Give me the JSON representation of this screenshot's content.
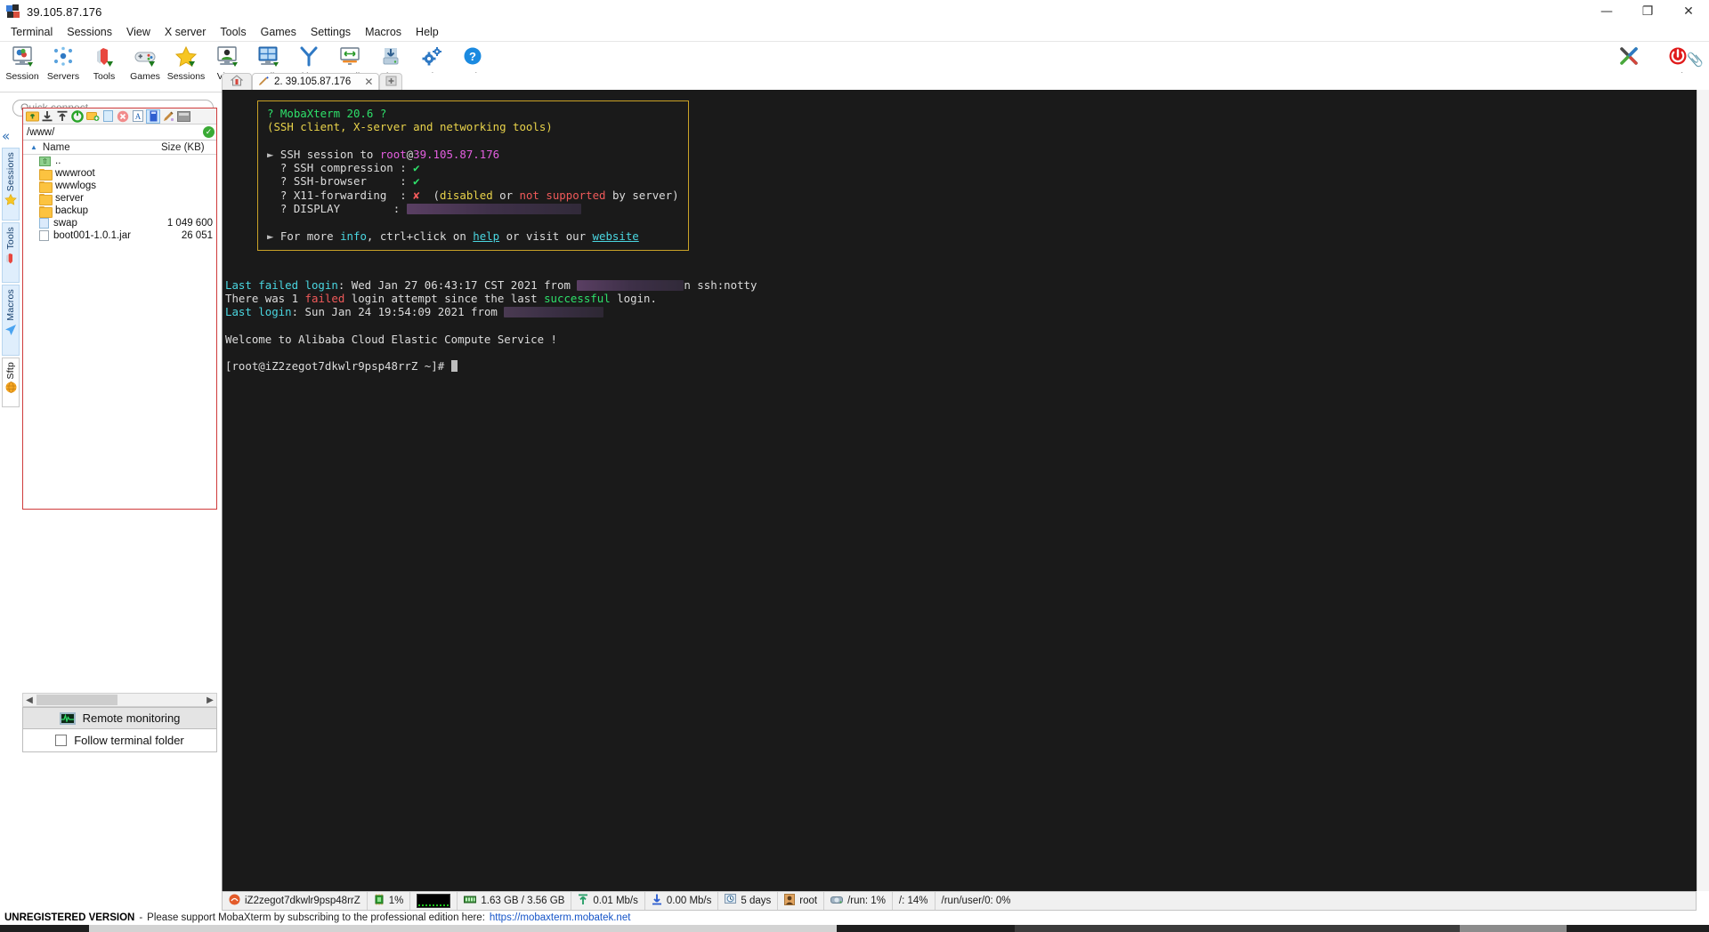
{
  "window": {
    "title": "39.105.87.176",
    "icon": "mobaxterm-logo-icon",
    "minimize": "—",
    "maximize": "❐",
    "close": "✕"
  },
  "menubar": {
    "items": [
      "Terminal",
      "Sessions",
      "View",
      "X server",
      "Tools",
      "Games",
      "Settings",
      "Macros",
      "Help"
    ]
  },
  "ribbon": {
    "items": [
      {
        "label": "Session",
        "icon": "session-icon"
      },
      {
        "label": "Servers",
        "icon": "servers-icon"
      },
      {
        "label": "Tools",
        "icon": "tools-icon"
      },
      {
        "label": "Games",
        "icon": "games-icon"
      },
      {
        "label": "Sessions",
        "icon": "sessions-star-icon"
      },
      {
        "label": "View",
        "icon": "view-icon"
      },
      {
        "label": "Split",
        "icon": "split-icon"
      },
      {
        "label": "MultiExec",
        "icon": "multiexec-icon"
      },
      {
        "label": "Tunneling",
        "icon": "tunneling-icon"
      },
      {
        "label": "Packages",
        "icon": "packages-icon"
      },
      {
        "label": "Settings",
        "icon": "settings-gear-icon"
      },
      {
        "label": "Help",
        "icon": "help-question-icon"
      }
    ],
    "right": [
      {
        "label": "X server",
        "icon": "x-server-icon"
      },
      {
        "label": "Exit",
        "icon": "exit-power-icon"
      }
    ]
  },
  "quick_connect": {
    "placeholder": "Quick connect..."
  },
  "side_tabs": [
    {
      "label": "Sessions",
      "icon": "star-icon",
      "active": false
    },
    {
      "label": "Tools",
      "icon": "tools-icon",
      "active": false
    },
    {
      "label": "Macros",
      "icon": "macros-icon",
      "active": false
    },
    {
      "label": "Sftp",
      "icon": "globe-icon",
      "active": true
    }
  ],
  "file_browser": {
    "toolbar_icons": [
      "go-up-icon",
      "download-icon",
      "upload-icon",
      "refresh-icon",
      "new-folder-icon",
      "new-file-icon",
      "delete-icon",
      "text-edit-icon",
      "bookmark-icon",
      "permissions-icon",
      "terminal-icon"
    ],
    "path": "/www/",
    "path_status_icon": "check-circle-icon",
    "columns": {
      "name": "Name",
      "size": "Size (KB)"
    },
    "rows": [
      {
        "name": "..",
        "size": "",
        "type": "parent"
      },
      {
        "name": "wwwroot",
        "size": "",
        "type": "folder"
      },
      {
        "name": "wwwlogs",
        "size": "",
        "type": "folder"
      },
      {
        "name": "server",
        "size": "",
        "type": "folder"
      },
      {
        "name": "backup",
        "size": "",
        "type": "folder"
      },
      {
        "name": "swap",
        "size": "1 049 600",
        "type": "file-blue"
      },
      {
        "name": "boot001-1.0.1.jar",
        "size": "26 051",
        "type": "file"
      }
    ],
    "remote_monitoring": "Remote monitoring",
    "follow_terminal_folder": "Follow terminal folder",
    "follow_checked": false
  },
  "tabs": {
    "home_icon": "home-icon",
    "items": [
      {
        "label": "2. 39.105.87.176",
        "icon": "ssh-icon",
        "active": true,
        "close": "✕"
      }
    ],
    "new_tab": "+"
  },
  "terminal": {
    "banner": {
      "title": "? MobaXterm 20.6 ?",
      "subtitle": "(SSH client, X-server and networking tools)",
      "session_prefix": "SSH session to ",
      "session_user": "root",
      "session_at": "@",
      "session_host": "39.105.87.176",
      "rows": [
        {
          "label": "? SSH compression",
          "value": "✔",
          "value_class": "ok"
        },
        {
          "label": "? SSH-browser",
          "value": "✔",
          "value_class": "ok"
        },
        {
          "label": "? X11-forwarding",
          "value": "✘",
          "value_class": "bad",
          "note_open": " (",
          "note_yellow": "disabled",
          "note_mid": " or ",
          "note_red": "not supported",
          "note_close": " by server)"
        },
        {
          "label": "? DISPLAY",
          "value": "",
          "value_class": "redacted"
        }
      ],
      "footer_prefix": "For more ",
      "footer_info": "info",
      "footer_mid": ", ctrl+click on ",
      "footer_help": "help",
      "footer_or": " or visit our ",
      "footer_website": "website"
    },
    "lines": {
      "last_failed_label": "Last failed login",
      "last_failed_rest": ": Wed Jan 27 06:43:17 CST 2021 from ",
      "last_failed_tail": "n ssh:notty",
      "attempt_pre": "There was 1 ",
      "attempt_failed": "failed",
      "attempt_mid": " login attempt since the last ",
      "attempt_success": "successful",
      "attempt_end": " login.",
      "last_login_label": "Last login",
      "last_login_rest": ": Sun Jan 24 19:54:09 2021 from ",
      "welcome": "Welcome to Alibaba Cloud Elastic Compute Service !",
      "prompt": "[root@iZ2zegot7dkwlr9psp48rrZ ~]#"
    }
  },
  "statusbar": {
    "items": [
      {
        "icon": "host-icon",
        "text": "iZ2zegot7dkwlr9psp48rrZ"
      },
      {
        "icon": "cpu-icon",
        "text": "1%"
      },
      {
        "icon": "graph-icon",
        "text": ""
      },
      {
        "icon": "memory-icon",
        "text": "1.63 GB / 3.56 GB"
      },
      {
        "icon": "upload-icon",
        "text": "0.01 Mb/s"
      },
      {
        "icon": "download-icon",
        "text": "0.00 Mb/s"
      },
      {
        "icon": "uptime-icon",
        "text": "5 days"
      },
      {
        "icon": "user-icon",
        "text": "root"
      },
      {
        "icon": "disk-icon",
        "text": "/run: 1%"
      },
      {
        "icon": "",
        "text": "/: 14%"
      },
      {
        "icon": "",
        "text": "/run/user/0: 0%"
      }
    ]
  },
  "footer": {
    "unregistered": "UNREGISTERED VERSION",
    "dash": "-",
    "message": "Please support MobaXterm by subscribing to the professional edition here:",
    "link": "https://mobaxterm.mobatek.net"
  },
  "colors": {
    "accent": "#2f79c4",
    "terminal_bg": "#1a1a1a",
    "banner_border": "#c9a227",
    "green": "#2ee06a",
    "yellow": "#e8d24a",
    "cyan": "#4ad6e0",
    "magenta": "#e45fe0",
    "red": "#f05a5a",
    "exit_red": "#e01b1b",
    "panel_border": "#cf3b3b"
  }
}
